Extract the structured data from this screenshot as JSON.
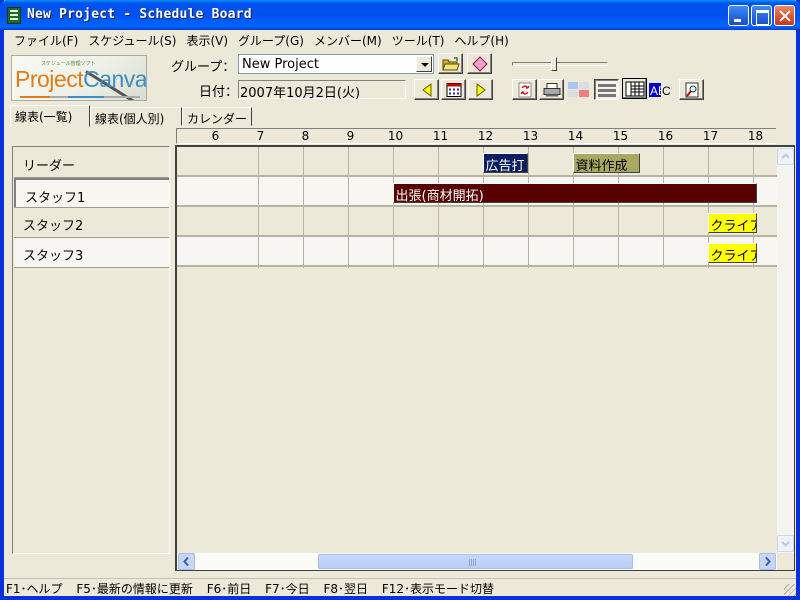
{
  "window": {
    "title": "New Project - Schedule Board",
    "controls": [
      "minimize",
      "maximize",
      "close"
    ]
  },
  "menu": [
    {
      "label": "ファイル(F)"
    },
    {
      "label": "スケジュール(S)"
    },
    {
      "label": "表示(V)"
    },
    {
      "label": "グループ(G)"
    },
    {
      "label": "メンバー(M)"
    },
    {
      "label": "ツール(T)"
    },
    {
      "label": "ヘルプ(H)"
    }
  ],
  "logo": {
    "text_a": "Project",
    "text_b": "Canvas",
    "tagline": "スケジュール管理ソフト"
  },
  "toolbar": {
    "group_label": "グループ：",
    "group_value": "New Project",
    "date_label": "日付：",
    "date_value": "2007年10月2日(火)",
    "slider_value_fraction": 0.45,
    "buttons": {
      "open": "open-folder-icon",
      "diamond": "diamond-icon",
      "prev": "previous-day-icon",
      "calendar": "calendar-icon",
      "next": "next-day-icon",
      "refresh": "refresh-icon",
      "print": "print-icon",
      "color_grid": "color-grid-icon",
      "list_view": "list-view-icon",
      "table_view": "table-view-icon",
      "text_style": "abc-text-icon",
      "search": "search-icon"
    }
  },
  "tabs": [
    {
      "label": "線表(一覧)",
      "active": true
    },
    {
      "label": "線表(個人別)",
      "active": false
    },
    {
      "label": "カレンダー",
      "active": false
    }
  ],
  "schedule": {
    "hours": [
      "6",
      "7",
      "8",
      "9",
      "10",
      "11",
      "12",
      "13",
      "14",
      "15",
      "16",
      "17",
      "18"
    ],
    "start_hour": 5.1,
    "members": [
      {
        "name": "リーダー"
      },
      {
        "name": "スタッフ1"
      },
      {
        "name": "スタッフ2"
      },
      {
        "name": "スタッフ3"
      }
    ],
    "events": [
      {
        "row": 0,
        "title": "広告打",
        "start": 11,
        "end": 12,
        "bg": "#0a1f62",
        "fg": "#ffffff"
      },
      {
        "row": 0,
        "title": "資料作成",
        "start": 13,
        "end": 14.5,
        "bg": "#a9a862",
        "fg": "#000000"
      },
      {
        "row": 1,
        "title": "出張(商材開拓)",
        "start": 9,
        "end": 18,
        "bg": "#560000",
        "fg": "#ffffff"
      },
      {
        "row": 2,
        "title": "クライアント打",
        "start": 16,
        "end": 18,
        "bg": "#ffff00",
        "fg": "#000000"
      },
      {
        "row": 3,
        "title": "クライアント打",
        "start": 16,
        "end": 18,
        "bg": "#ffff00",
        "fg": "#000000"
      }
    ]
  },
  "status": [
    "F1･ヘルプ",
    "F5･最新の情報に更新",
    "F6･前日",
    "F7･今日",
    "F8･翌日",
    "F12･表示モード切替"
  ]
}
